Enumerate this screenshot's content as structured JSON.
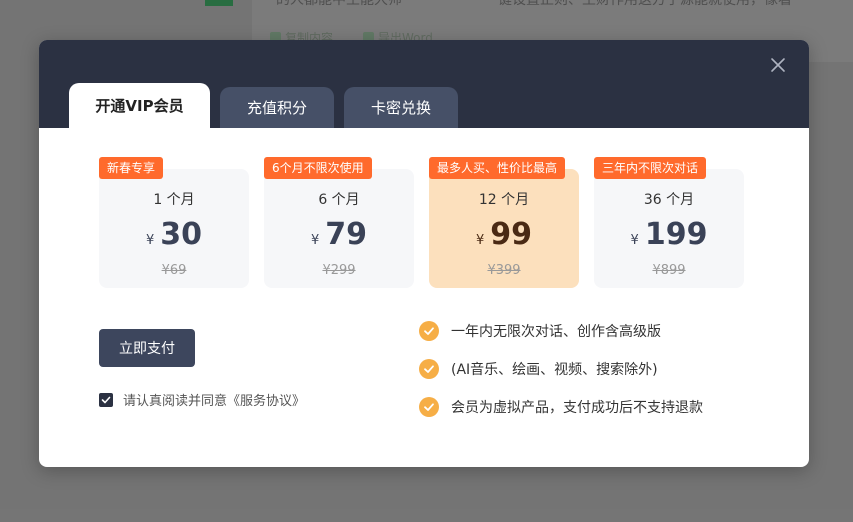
{
  "background": {
    "text1": "的人都能中生能大师",
    "text2": "一键设置正则、生财作用这方子源能就使用，像看",
    "action_copy": "复制内容",
    "action_word": "导出Word"
  },
  "tabs": [
    {
      "label": "开通VIP会员",
      "active": true
    },
    {
      "label": "充值积分",
      "active": false
    },
    {
      "label": "卡密兑换",
      "active": false
    }
  ],
  "plans": [
    {
      "badge": "新春专享",
      "duration": "1 个月",
      "currency": "¥",
      "price": "30",
      "original": "¥69",
      "selected": false
    },
    {
      "badge": "6个月不限次使用",
      "duration": "6 个月",
      "currency": "¥",
      "price": "79",
      "original": "¥299",
      "selected": false
    },
    {
      "badge": "最多人买、性价比最高",
      "duration": "12 个月",
      "currency": "¥",
      "price": "99",
      "original": "¥399",
      "selected": true
    },
    {
      "badge": "三年内不限次对话",
      "duration": "36 个月",
      "currency": "¥",
      "price": "199",
      "original": "¥899",
      "selected": false
    }
  ],
  "pay_button": "立即支付",
  "agreement": {
    "text": "请认真阅读并同意《服务协议》",
    "checked": true
  },
  "features": [
    "一年内无限次对话、创作含高级版",
    "(AI音乐、绘画、视频、搜索除外)",
    "会员为虚拟产品，支付成功后不支持退款"
  ],
  "colors": {
    "header": "#2b3142",
    "badge": "#ff6a2c",
    "selected_plan": "#fce0bd",
    "check": "#f6ae46",
    "pay_button": "#3d465d"
  }
}
